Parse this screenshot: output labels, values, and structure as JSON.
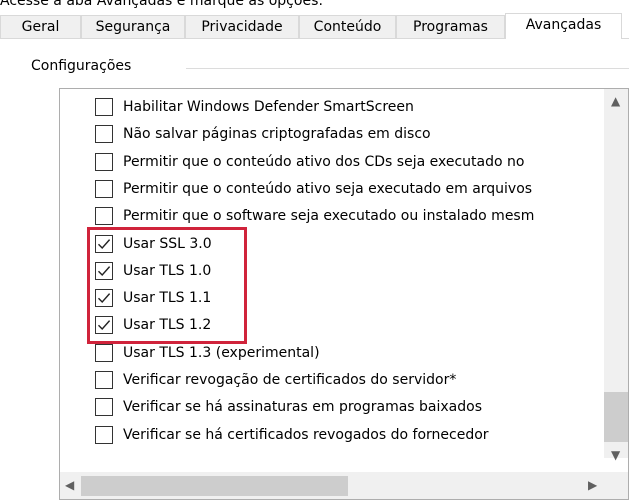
{
  "caption": "Acesse a aba Avançadas e marque as opções:",
  "tabs": [
    {
      "label": "Geral"
    },
    {
      "label": "Segurança"
    },
    {
      "label": "Privacidade"
    },
    {
      "label": "Conteúdo"
    },
    {
      "label": "Programas"
    },
    {
      "label": "Avançadas",
      "active": true
    }
  ],
  "group": {
    "label": "Configurações"
  },
  "settings": [
    {
      "label": "Habilitar Windows Defender SmartScreen",
      "checked": false
    },
    {
      "label": "Não salvar páginas criptografadas em disco",
      "checked": false
    },
    {
      "label": "Permitir que o conteúdo ativo dos CDs seja executado no",
      "checked": false
    },
    {
      "label": "Permitir que o conteúdo ativo seja executado em arquivos",
      "checked": false
    },
    {
      "label": "Permitir que o software seja executado ou instalado mesm",
      "checked": false
    },
    {
      "label": "Usar SSL 3.0",
      "checked": true
    },
    {
      "label": "Usar TLS 1.0",
      "checked": true
    },
    {
      "label": "Usar TLS 1.1",
      "checked": true
    },
    {
      "label": "Usar TLS 1.2",
      "checked": true
    },
    {
      "label": "Usar TLS 1.3 (experimental)",
      "checked": false
    },
    {
      "label": "Verificar revogação de certificados do servidor*",
      "checked": false
    },
    {
      "label": "Verificar se há assinaturas em programas baixados",
      "checked": false
    },
    {
      "label": "Verificar se há certificados revogados do fornecedor",
      "checked": false
    }
  ],
  "highlight_color": "#d0233b",
  "icons": {
    "scroll_up": "▲",
    "scroll_down": "▼",
    "scroll_left": "◀",
    "scroll_right": "▶"
  }
}
